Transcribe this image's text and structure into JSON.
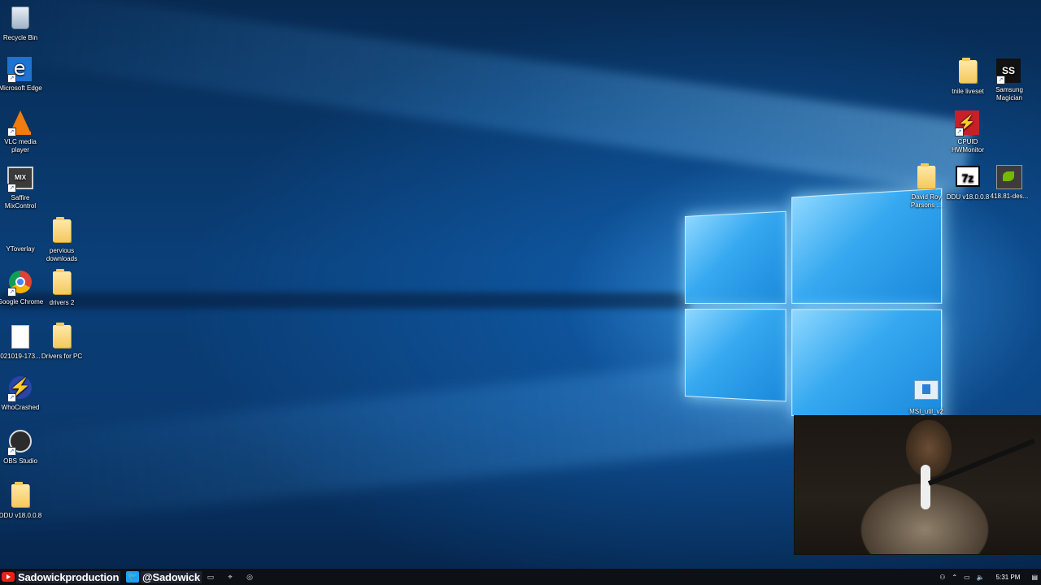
{
  "desktop": {
    "icons_left": [
      {
        "label": "Recycle Bin",
        "icon": "recycle-bin-icon"
      },
      {
        "label": "Microsoft Edge",
        "icon": "edge-icon"
      },
      {
        "label": "VLC media player",
        "icon": "vlc-icon"
      },
      {
        "label": "Saffire MixControl",
        "icon": "mixcontrol-icon"
      },
      {
        "label": "YToverlay",
        "icon": "blank-icon"
      },
      {
        "label": "pervious downloads",
        "icon": "folder-icon"
      },
      {
        "label": "Google Chrome",
        "icon": "chrome-icon"
      },
      {
        "label": "drivers 2",
        "icon": "folder-icon"
      },
      {
        "label": "021019-173...",
        "icon": "file-icon"
      },
      {
        "label": "Drivers for PC",
        "icon": "folder-icon"
      },
      {
        "label": "WhoCrashed",
        "icon": "whocrashed-icon"
      },
      {
        "label": "OBS Studio",
        "icon": "obs-icon"
      },
      {
        "label": "DDU v18.0.0.8",
        "icon": "folder-icon"
      }
    ],
    "icons_right": [
      {
        "label": "tnile liveset",
        "icon": "folder-icon"
      },
      {
        "label": "Samsung Magician",
        "icon": "samsung-magician-icon"
      },
      {
        "label": "CPUID HWMonitor",
        "icon": "hwmonitor-icon"
      },
      {
        "label": "David Roy Parsons ...",
        "icon": "folder-icon"
      },
      {
        "label": "DDU v18.0.0.8",
        "icon": "7zip-icon"
      },
      {
        "label": "418.81-des...",
        "icon": "nvidia-icon"
      },
      {
        "label": "MSI_util_v2",
        "icon": "msi-util-icon"
      }
    ]
  },
  "taskbar": {
    "youtube_handle": "Sadowickproduction",
    "twitter_handle": "@Sadowick",
    "clock": "5:31 PM"
  }
}
